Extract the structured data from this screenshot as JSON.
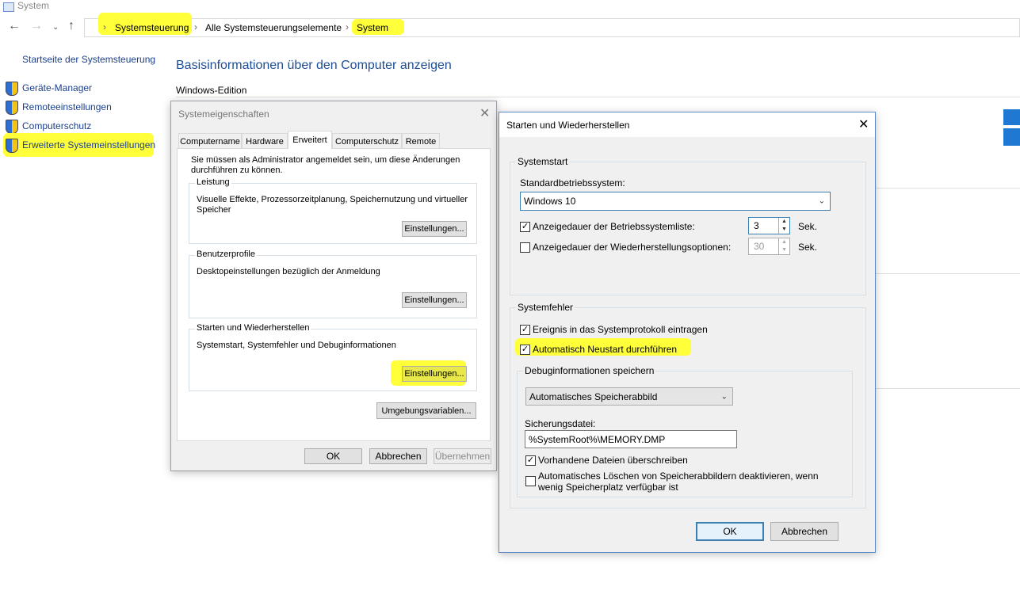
{
  "window": {
    "title": "System"
  },
  "address": {
    "crumbs": [
      "Systemsteuerung",
      "Alle Systemsteuerungselemente",
      "System"
    ],
    "separator": "›"
  },
  "sidebar": {
    "home": "Startseite der Systemsteuerung",
    "items": [
      {
        "label": "Geräte-Manager",
        "icon": "shield-icon"
      },
      {
        "label": "Remoteeinstellungen",
        "icon": "shield-icon"
      },
      {
        "label": "Computerschutz",
        "icon": "shield-icon"
      },
      {
        "label": "Erweiterte Systemeinstellungen",
        "icon": "shield-icon"
      }
    ]
  },
  "main": {
    "title": "Basisinformationen über den Computer anzeigen",
    "section": "Windows-Edition"
  },
  "sysprops": {
    "title": "Systemeigenschaften",
    "tabs": [
      "Computername",
      "Hardware",
      "Erweitert",
      "Computerschutz",
      "Remote"
    ],
    "active_tab": "Erweitert",
    "admin_note": "Sie müssen als Administrator angemeldet sein, um diese Änderungen durchführen zu können.",
    "leistung": {
      "label": "Leistung",
      "desc": "Visuelle Effekte, Prozessorzeitplanung, Speichernutzung und virtueller Speicher",
      "button": "Einstellungen..."
    },
    "profile": {
      "label": "Benutzerprofile",
      "desc": "Desktopeinstellungen bezüglich der Anmeldung",
      "button": "Einstellungen..."
    },
    "starten": {
      "label": "Starten und Wiederherstellen",
      "desc": "Systemstart, Systemfehler und Debuginformationen",
      "button": "Einstellungen..."
    },
    "env_button": "Umgebungsvariablen...",
    "ok": "OK",
    "cancel": "Abbrechen",
    "apply": "Übernehmen"
  },
  "startup": {
    "title": "Starten und Wiederherstellen",
    "systemstart": {
      "label": "Systemstart",
      "default_os_label": "Standardbetriebssystem:",
      "default_os": "Windows 10",
      "show_list_label": "Anzeigedauer der Betriebssystemliste:",
      "show_list_checked": true,
      "show_list_value": "3",
      "recovery_label": "Anzeigedauer der Wiederherstellungsoptionen:",
      "recovery_checked": false,
      "recovery_value": "30",
      "unit": "Sek."
    },
    "systemfehler": {
      "label": "Systemfehler",
      "log_event": "Ereignis in das Systemprotokoll eintragen",
      "log_event_checked": true,
      "auto_restart": "Automatisch Neustart durchführen",
      "auto_restart_checked": true,
      "debug_label": "Debuginformationen speichern",
      "debug_value": "Automatisches Speicherabbild",
      "dumpfile_label": "Sicherungsdatei:",
      "dumpfile_value": "%SystemRoot%\\MEMORY.DMP",
      "overwrite": "Vorhandene Dateien überschreiben",
      "overwrite_checked": true,
      "disable_delete": "Automatisches Löschen von Speicherabbildern deaktivieren, wenn wenig Speicherplatz verfügbar ist",
      "disable_delete_checked": false
    },
    "ok": "OK",
    "cancel": "Abbrechen"
  },
  "colors": {
    "highlight": "#ffff3a",
    "link": "#1a3f8c",
    "title": "#1e4e97"
  }
}
